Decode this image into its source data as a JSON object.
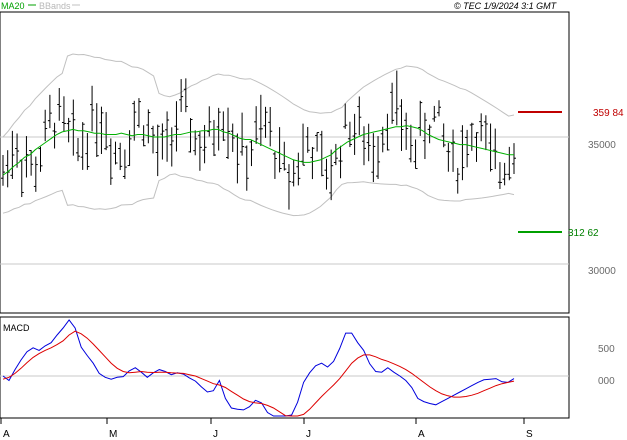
{
  "header": {
    "ma20_label": "MA20",
    "bbands_label": "BBands",
    "copyright": "© TEC 1/9/2024 3:1 GMT"
  },
  "macd_label": "MACD",
  "colors": {
    "price": "#000000",
    "ma20": "#00b000",
    "bbands": "#c0c0c0",
    "resistance": "#c00000",
    "support": "#00a000",
    "macd": "#0000dd",
    "signal": "#dd0000",
    "grid": "#c8c8c8"
  },
  "chart_data": [
    {
      "type": "ohlc",
      "price_axis": {
        "ticks": [
          "35000",
          "30000"
        ],
        "range": [
          28000,
          38800
        ]
      },
      "x_ticks": [
        "A",
        "M",
        "J",
        "J",
        "A",
        "S"
      ],
      "resistance": {
        "value": 35984,
        "label": "359 84"
      },
      "support": {
        "value": 31262,
        "label": "312 62"
      },
      "series": [
        {
          "name": "MA20",
          "values": [
            33500,
            33650,
            33850,
            34000,
            34200,
            34300,
            34500,
            34650,
            34800,
            34950,
            35100,
            35200,
            35250,
            35300,
            35250,
            35250,
            35200,
            35150,
            35150,
            35100,
            35100,
            35100,
            35150,
            35100,
            35050,
            35100,
            35100,
            35050,
            35000,
            35000,
            35000,
            35050,
            35100,
            35100,
            35150,
            35200,
            35200,
            35250,
            35250,
            35300,
            35300,
            35200,
            35150,
            35050,
            34950,
            34900,
            34900,
            34800,
            34700,
            34600,
            34500,
            34400,
            34300,
            34200,
            34100,
            34050,
            34000,
            34000,
            34050,
            34100,
            34200,
            34300,
            34500,
            34650,
            34800,
            34900,
            35000,
            35100,
            35150,
            35200,
            35250,
            35300,
            35350,
            35400,
            35400,
            35450,
            35400,
            35350,
            35250,
            35100,
            35000,
            34900,
            34850,
            34800,
            34750,
            34700,
            34700,
            34650,
            34600,
            34550,
            34500,
            34450,
            34400,
            34350,
            34300,
            34300
          ]
        },
        {
          "name": "BBands",
          "values": []
        }
      ],
      "ohlc_summary": "daily bars, approx. Apr–Sep, range ≈ 31,900 – 37,300"
    },
    {
      "type": "line",
      "title": "MACD",
      "y_ticks": [
        "500",
        "000"
      ],
      "series": [
        {
          "name": "MACD",
          "values": [
            0,
            -70,
            100,
            250,
            380,
            440,
            400,
            470,
            520,
            640,
            750,
            930,
            750,
            450,
            320,
            200,
            40,
            -20,
            -50,
            -20,
            -10,
            80,
            130,
            60,
            -20,
            50,
            100,
            70,
            20,
            50,
            30,
            -30,
            -80,
            -170,
            -250,
            -230,
            -70,
            -350,
            -500,
            -520,
            -530,
            -480,
            -380,
            -420,
            -570,
            -700,
            -830,
            -770,
            -610,
            -410,
            -100,
            50,
            160,
            200,
            140,
            230,
            430,
            670,
            670,
            520,
            400,
            190,
            70,
            60,
            130,
            60,
            0,
            -70,
            -180,
            -350,
            -400,
            -430,
            -450,
            -400,
            -350,
            -300,
            -250,
            -200,
            -150,
            -100,
            -60,
            -50,
            -40,
            -90,
            -100,
            -40
          ]
        },
        {
          "name": "Signal",
          "values": [
            -50,
            -20,
            40,
            120,
            210,
            290,
            350,
            400,
            440,
            490,
            550,
            640,
            700,
            660,
            590,
            500,
            400,
            300,
            200,
            120,
            70,
            50,
            60,
            70,
            60,
            55,
            60,
            60,
            50,
            45,
            40,
            20,
            0,
            -40,
            -80,
            -120,
            -140,
            -180,
            -240,
            -300,
            -360,
            -400,
            -420,
            -430,
            -460,
            -500,
            -560,
            -620,
            -640,
            -640,
            -600,
            -520,
            -420,
            -320,
            -230,
            -140,
            -40,
            80,
            200,
            280,
            330,
            330,
            300,
            260,
            230,
            190,
            150,
            100,
            40,
            -30,
            -100,
            -170,
            -230,
            -280,
            -310,
            -330,
            -330,
            -320,
            -300,
            -270,
            -230,
            -190,
            -150,
            -120,
            -100,
            -80
          ]
        }
      ]
    }
  ]
}
